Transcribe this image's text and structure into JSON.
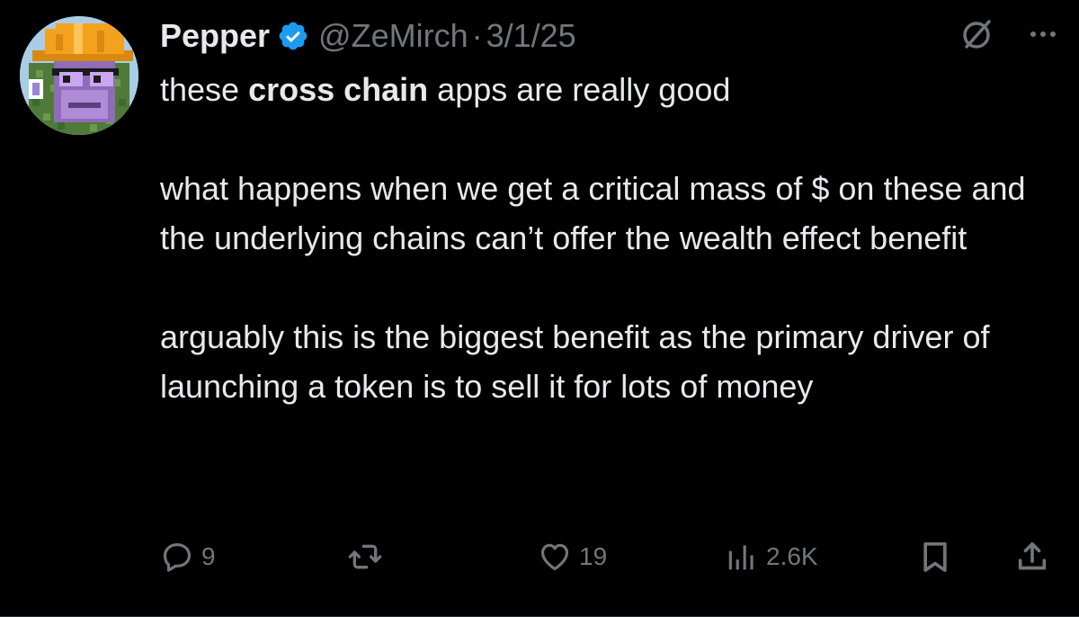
{
  "author": {
    "display_name": "Pepper",
    "handle": "@ZeMirch",
    "separator": "·",
    "date": "3/1/25",
    "verified": true
  },
  "body": {
    "line1_pre": "these ",
    "line1_bold": "cross chain",
    "line1_post": " apps are really good",
    "para2": "what happens when we get a critical mass of $ on these and the underlying chains can’t offer the wealth effect benefit",
    "para3": "arguably this is the biggest benefit as the primary driver of launching a token is to sell it for lots of money"
  },
  "stats": {
    "replies": "9",
    "likes": "19",
    "views": "2.6K"
  },
  "icons": {
    "top_right": [
      "grok-icon",
      "more-icon"
    ],
    "actions": [
      "reply-icon",
      "repost-icon",
      "like-icon",
      "views-icon",
      "bookmark-icon",
      "share-icon"
    ]
  },
  "colors": {
    "background": "#000000",
    "text_primary": "#e7e9ea",
    "text_secondary": "#71767b",
    "verified_blue": "#1d9bf0",
    "avatar_bg": "#a9cde6"
  }
}
